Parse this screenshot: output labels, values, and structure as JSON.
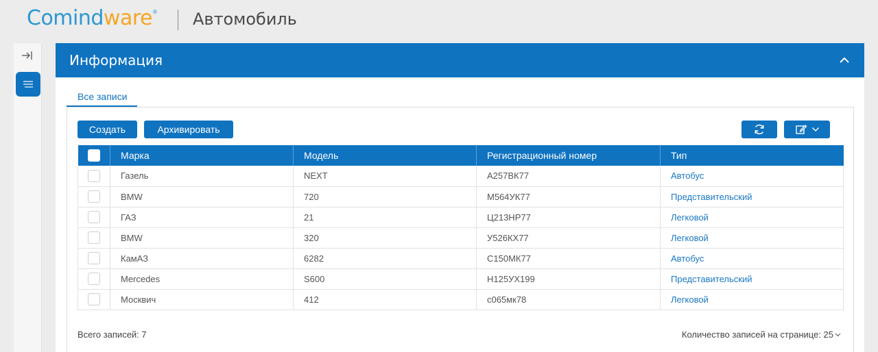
{
  "header": {
    "logo_part1": "Comind",
    "logo_part2": "ware",
    "logo_reg": "®",
    "page_title": "Автомобиль"
  },
  "panel": {
    "title": "Информация"
  },
  "tabs": [
    {
      "label": "Все записи"
    }
  ],
  "toolbar": {
    "create_label": "Создать",
    "archive_label": "Архивировать"
  },
  "table": {
    "columns": [
      "Марка",
      "Модель",
      "Регистрационный номер",
      "Тип"
    ],
    "rows": [
      {
        "brand": "Газель",
        "model": "NEXT",
        "reg": "А257ВК77",
        "type": "Автобус"
      },
      {
        "brand": "BMW",
        "model": "720",
        "reg": "М564УК77",
        "type": "Представительский"
      },
      {
        "brand": "ГАЗ",
        "model": "21",
        "reg": "Ц213НР77",
        "type": "Легковой"
      },
      {
        "brand": "BMW",
        "model": "320",
        "reg": "У526КХ77",
        "type": "Легковой"
      },
      {
        "brand": "КамАЗ",
        "model": "6282",
        "reg": "С150МК77",
        "type": "Автобус"
      },
      {
        "brand": "Mercedes",
        "model": "S600",
        "reg": "Н125УХ199",
        "type": "Представительский"
      },
      {
        "brand": "Москвич",
        "model": "412",
        "reg": "с065мк78",
        "type": "Легковой"
      }
    ]
  },
  "footer": {
    "total_label": "Всего записей: 7",
    "page_size_label": "Количество записей на странице: 25"
  },
  "icons": {
    "collapse": "collapse-sidebar-icon",
    "menu": "menu-icon",
    "chevron": "chevron-up-icon",
    "refresh": "refresh-icon",
    "edit": "edit-icon",
    "dropdown": "chevron-down-icon"
  },
  "colors": {
    "accent": "#0f73c0",
    "link": "#1a78c2",
    "logo_blue": "#2d97d3",
    "logo_orange": "#f5a623"
  }
}
